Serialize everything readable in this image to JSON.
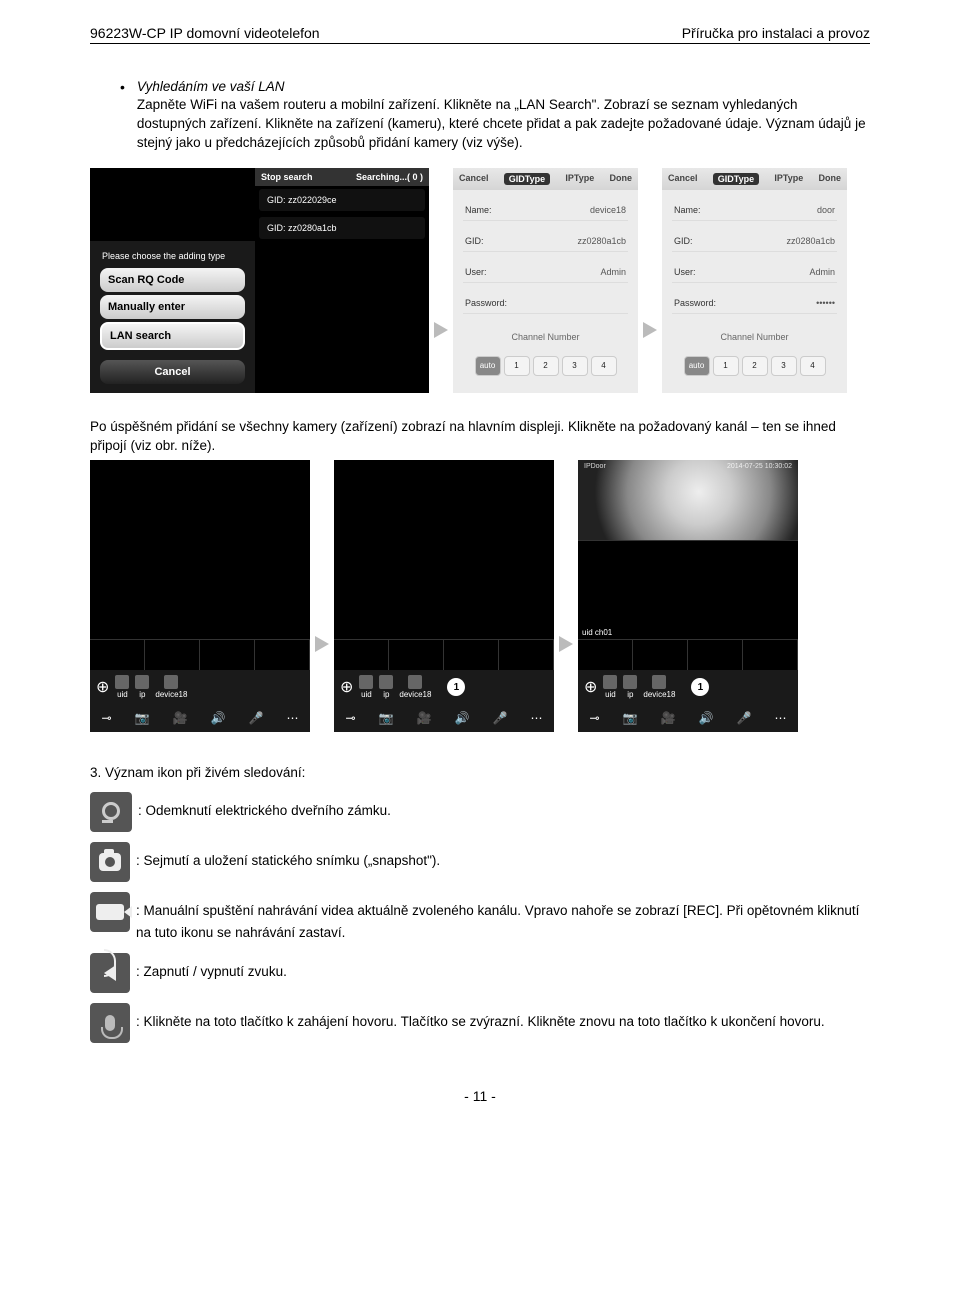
{
  "header": {
    "left": "96223W-CP  IP domovní videotelefon",
    "right": "Příručka pro instalaci a provoz"
  },
  "section1": {
    "bullet_title": "Vyhledáním ve vaší LAN",
    "text1": "Zapněte WiFi na vašem routeru a mobilní zařízení. Klikněte na „LAN Search\". Zobrazí se seznam vyhledaných dostupných zařízení. Klikněte na zařízení (kameru), které chcete přidat a pak zadejte požadované údaje. Význam údajů je stejný jako u předcházejících způsobů přidání kamery (viz výše)."
  },
  "chooser": {
    "title": "Please choose the adding type",
    "btn1": "Scan RQ Code",
    "btn2": "Manually enter",
    "btn3": "LAN search",
    "btn4": "Cancel"
  },
  "search": {
    "stop": "Stop search",
    "searching": "Searching...( 0 )",
    "gid1": "GID: zz022029ce",
    "gid2": "GID: zz0280a1cb"
  },
  "form": {
    "cancel": "Cancel",
    "gidtype": "GIDType",
    "iptype": "IPType",
    "done": "Done",
    "name_label": "Name:",
    "gid_label": "GID:",
    "user_label": "User:",
    "pass_label": "Password:",
    "channel": "Channel Number",
    "auto": "auto",
    "n1": "1",
    "n2": "2",
    "n3": "3",
    "n4": "4",
    "name_val1": "device18",
    "gid_val": "zz0280a1cb",
    "user_val": "Admin",
    "name_val2": "door",
    "pass_dots": "••••••"
  },
  "mid_text": "Po úspěšném přidání se všechny kamery (zařízení) zobrazí na hlavním displeji. Klikněte na požadovaný kanál – ten se ihned připojí (viz obr. níže).",
  "devices": {
    "uid": "uid",
    "ip": "ip",
    "device18": "device18",
    "uid_ch": "uid ch01",
    "badge": "1",
    "osd1": "IPDoor",
    "osd2": "2014-07-25 10:30:02"
  },
  "section3": {
    "heading": "3. Význam ikon při živém sledování:",
    "key": ": Odemknutí elektrického dveřního zámku.",
    "cam": ": Sejmutí a uložení statického snímku („snapshot\").",
    "rec": ": Manuální spuštění nahrávání videa aktuálně zvoleného kanálu. Vpravo nahoře se zobrazí [REC]. Při opětovném kliknutí na tuto ikonu se nahrávání zastaví.",
    "speaker": ": Zapnutí / vypnutí zvuku.",
    "mic": ": Klikněte na toto tlačítko k zahájení hovoru. Tlačítko se zvýrazní. Klikněte znovu na toto tlačítko k ukončení hovoru."
  },
  "footer": "- 11 -"
}
